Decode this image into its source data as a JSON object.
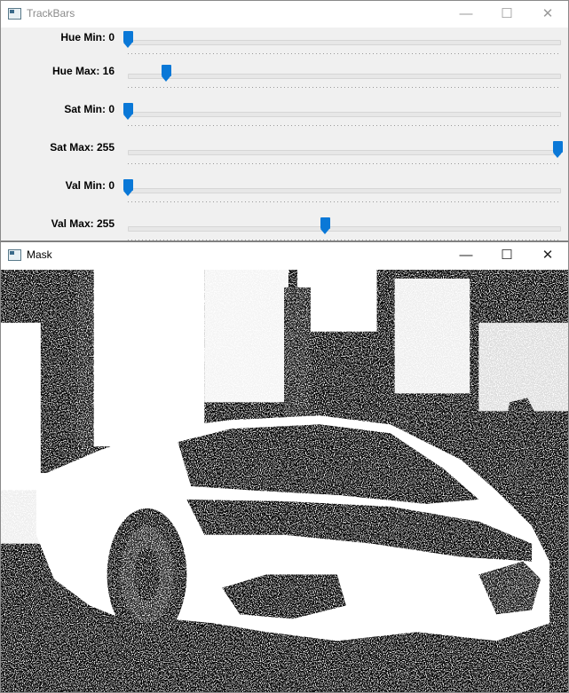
{
  "trackbars_window": {
    "title": "TrackBars",
    "controls": {
      "minimize": "—",
      "maximize": "☐",
      "close": "✕"
    },
    "sliders": [
      {
        "label": "Hue Min: 0",
        "value": 0,
        "max": 179
      },
      {
        "label": "Hue Max: 16",
        "value": 16,
        "max": 179
      },
      {
        "label": "Sat Min: 0",
        "value": 0,
        "max": 255
      },
      {
        "label": "Sat Max: 255",
        "value": 255,
        "max": 255
      },
      {
        "label": "Val Min: 0",
        "value": 0,
        "max": 255
      },
      {
        "label": "Val Max: 255",
        "value": 255,
        "max": 255
      }
    ],
    "accent_color": "#0a78d7"
  },
  "mask_window": {
    "title": "Mask",
    "controls": {
      "minimize": "—",
      "maximize": "☐",
      "close": "✕"
    }
  }
}
